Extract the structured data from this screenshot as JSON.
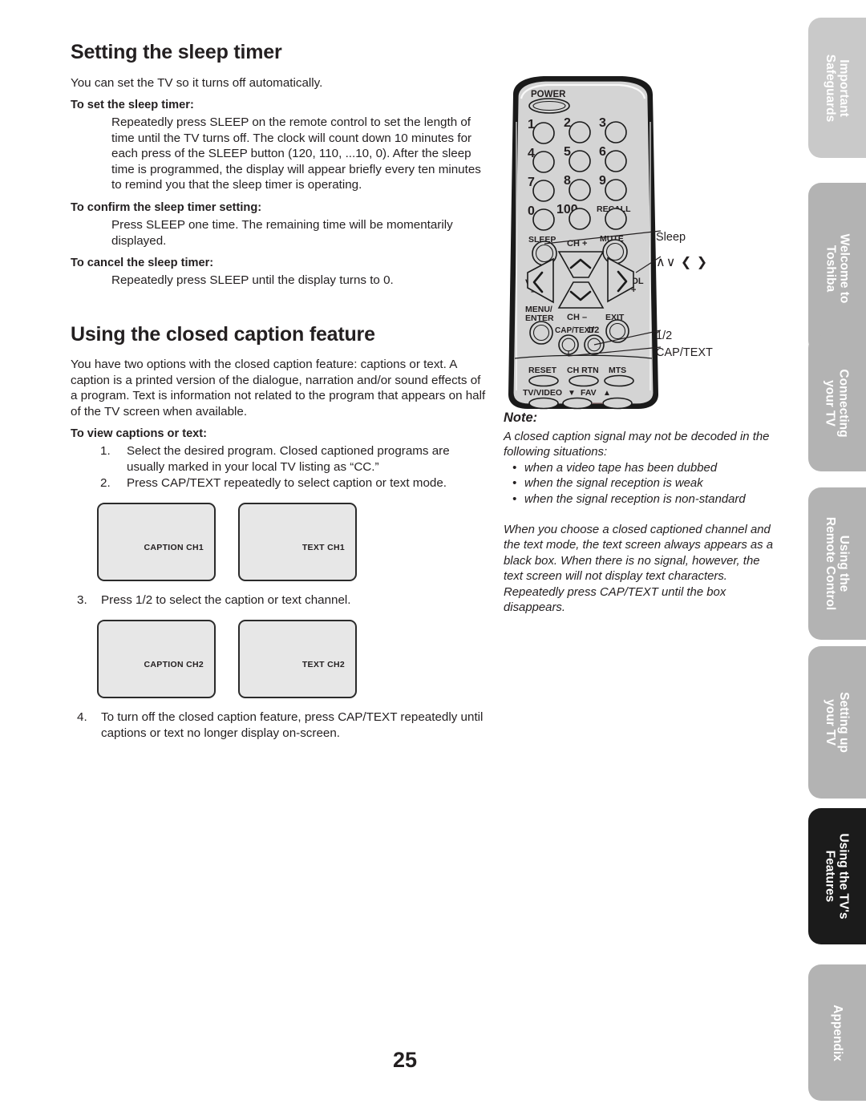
{
  "page": {
    "number": "25"
  },
  "sections": [
    {
      "id": "sleep-timer",
      "title": "Setting the sleep timer",
      "intro": "You can set the TV so it turns off automatically.",
      "blocks": [
        {
          "subhead": "To set the sleep timer:",
          "text": "Repeatedly press SLEEP on the remote control to set the length of time until the TV turns off. The clock will count down 10 minutes for each press of the SLEEP button (120, 110, ...10, 0). After the sleep time is programmed, the display will appear briefly every ten minutes to remind you that the sleep timer is operating."
        },
        {
          "subhead": "To confirm the sleep timer setting:",
          "text": "Press SLEEP one time. The remaining time will be momentarily displayed."
        },
        {
          "subhead": "To cancel the sleep timer:",
          "text": "Repeatedly press SLEEP until the display turns to 0."
        }
      ]
    },
    {
      "id": "closed-caption",
      "title": "Using the closed caption feature",
      "intro": "You have two options with the closed caption feature: captions or text. A caption is a printed version of the dialogue, narration and/or sound effects of a program. Text is information not related to the program that appears on half of the TV screen when available.",
      "subhead": "To view captions or text:",
      "steps": [
        {
          "num": "1.",
          "text": "Select the desired program. Closed captioned programs are usually marked in your local TV listing as “CC.”"
        },
        {
          "num": "2.",
          "text": "Press CAP/TEXT repeatedly to select caption or text mode."
        }
      ],
      "step3": {
        "num": "3.",
        "text": "Press 1/2 to select the caption or text channel."
      },
      "step4": {
        "num": "4.",
        "text": "To turn off the closed caption feature, press CAP/TEXT repeatedly until captions or text no longer display on-screen."
      },
      "screens_row1": [
        "CAPTION CH1",
        "TEXT CH1"
      ],
      "screens_row2": [
        "CAPTION CH2",
        "TEXT CH2"
      ]
    }
  ],
  "remote": {
    "power_label": "POWER",
    "keypad": [
      "1",
      "2",
      "3",
      "4",
      "5",
      "6",
      "7",
      "8",
      "9",
      "0",
      "100",
      "RECALL"
    ],
    "sleep_label": "SLEEP",
    "mute_label": "MUTE",
    "ch_up_label": "CH +",
    "ch_down_label": "CH –",
    "vol_down_label": "VOL",
    "vol_down_sign": "–",
    "vol_up_label": "VOL",
    "vol_up_sign": "+",
    "menu_label_line1": "MENU/",
    "menu_label_line2": "ENTER",
    "exit_label": "EXIT",
    "captext_label": "CAP/TEXT",
    "half_label": "1/2",
    "reset_label": "RESET",
    "chrtn_label": "CH RTN",
    "mts_label": "MTS",
    "tvvideo_label": "TV/VIDEO",
    "fav_label": "FAV",
    "fav_down": "▼",
    "fav_up": "▲"
  },
  "callouts": {
    "sleep": "Sleep",
    "arrows": "∧∨ ❮ ❯",
    "half": "1/2",
    "captext": "CAP/TEXT"
  },
  "note": {
    "title": "Note:",
    "para1": "A closed caption signal may not be decoded in the following situations:",
    "bullets": [
      "when a video tape has been dubbed",
      "when the signal reception is weak",
      "when the signal reception is non-standard"
    ],
    "para2": "When you choose a closed captioned channel and the text mode, the text screen always appears as a black box. When there is no signal, however, the text screen will not display text characters. Repeatedly press CAP/TEXT until the box disappears."
  },
  "tabs": [
    {
      "label": "Important\nSafeguards",
      "line1": "Important",
      "line2": "Safeguards",
      "active": false,
      "shade": "light"
    },
    {
      "label": "Welcome to Toshiba",
      "line1": "Welcome to",
      "line2": "Toshiba",
      "active": false,
      "shade": "mid"
    },
    {
      "label": "Connecting your TV",
      "line1": "Connecting",
      "line2": "your TV",
      "active": false,
      "shade": "mid"
    },
    {
      "label": "Using the Remote Control",
      "line1": "Using the",
      "line2": "Remote Control",
      "active": false,
      "shade": "mid"
    },
    {
      "label": "Setting up your TV",
      "line1": "Setting up",
      "line2": "your TV",
      "active": false,
      "shade": "mid"
    },
    {
      "label": "Using the TV's Features",
      "line1": "Using the TV's",
      "line2": "Features",
      "active": true,
      "shade": "active"
    },
    {
      "label": "Appendix",
      "line1": "Appendix",
      "line2": "",
      "active": false,
      "shade": "mid"
    }
  ],
  "colors": {
    "ink": "#231f20",
    "tab_light": "#c9c9c9",
    "tab_mid": "#b3b3b3",
    "tab_active": "#1b1b1b",
    "screen_fill": "#e7e7e7",
    "remote_body": "#d4d4d4"
  }
}
